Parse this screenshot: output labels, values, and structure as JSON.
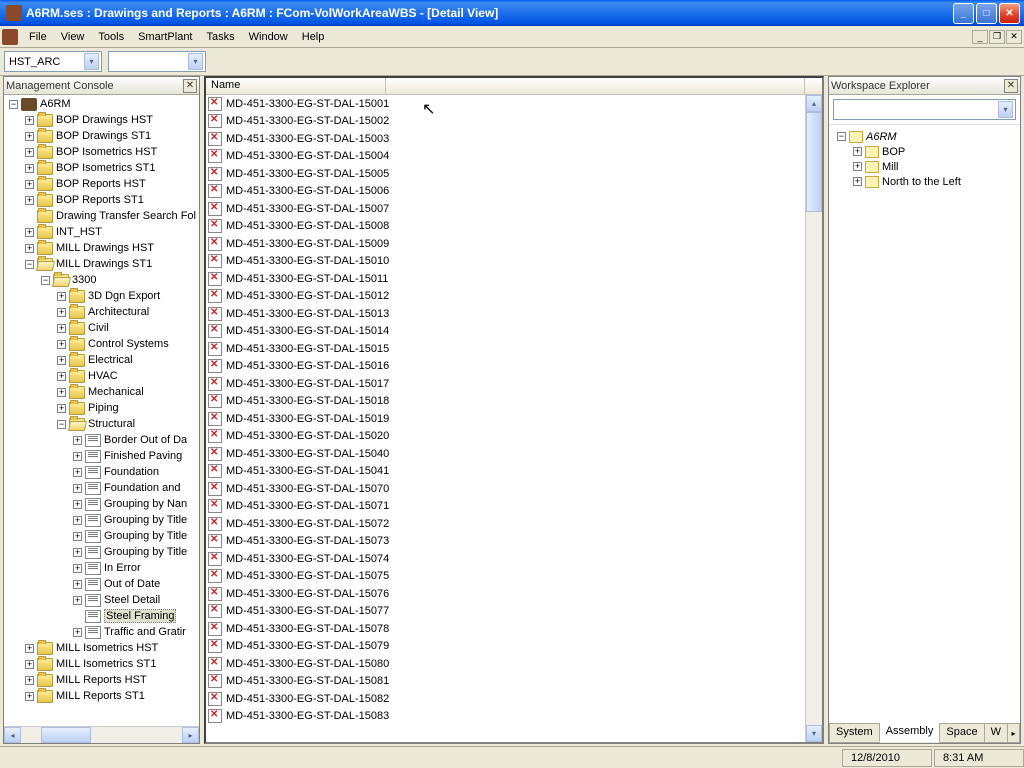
{
  "window": {
    "title": "A6RM.ses : Drawings and Reports : A6RM : FCom-VolWorkAreaWBS - [Detail View]"
  },
  "menu": {
    "items": [
      "File",
      "View",
      "Tools",
      "SmartPlant",
      "Tasks",
      "Window",
      "Help"
    ]
  },
  "toolbar": {
    "combo1_value": "HST_ARC",
    "combo2_value": ""
  },
  "left_panel": {
    "title": "Management Console",
    "tree": [
      {
        "depth": 0,
        "exp": "-",
        "icon": "root",
        "label": "A6RM"
      },
      {
        "depth": 1,
        "exp": "+",
        "icon": "folder",
        "label": "BOP Drawings HST"
      },
      {
        "depth": 1,
        "exp": "+",
        "icon": "folder",
        "label": "BOP Drawings ST1"
      },
      {
        "depth": 1,
        "exp": "+",
        "icon": "folder",
        "label": "BOP Isometrics HST"
      },
      {
        "depth": 1,
        "exp": "+",
        "icon": "folder",
        "label": "BOP Isometrics ST1"
      },
      {
        "depth": 1,
        "exp": "+",
        "icon": "folder",
        "label": "BOP Reports HST"
      },
      {
        "depth": 1,
        "exp": "+",
        "icon": "folder",
        "label": "BOP Reports ST1"
      },
      {
        "depth": 1,
        "exp": "",
        "icon": "folder",
        "label": "Drawing Transfer Search Fol"
      },
      {
        "depth": 1,
        "exp": "+",
        "icon": "folder",
        "label": "INT_HST"
      },
      {
        "depth": 1,
        "exp": "+",
        "icon": "folder",
        "label": "MILL Drawings HST"
      },
      {
        "depth": 1,
        "exp": "-",
        "icon": "folder-open",
        "label": "MILL Drawings ST1"
      },
      {
        "depth": 2,
        "exp": "-",
        "icon": "folder-open",
        "label": "3300"
      },
      {
        "depth": 3,
        "exp": "+",
        "icon": "folder",
        "label": "3D Dgn Export"
      },
      {
        "depth": 3,
        "exp": "+",
        "icon": "folder",
        "label": "Architectural"
      },
      {
        "depth": 3,
        "exp": "+",
        "icon": "folder",
        "label": "Civil"
      },
      {
        "depth": 3,
        "exp": "+",
        "icon": "folder",
        "label": "Control Systems"
      },
      {
        "depth": 3,
        "exp": "+",
        "icon": "folder",
        "label": "Electrical"
      },
      {
        "depth": 3,
        "exp": "+",
        "icon": "folder",
        "label": "HVAC"
      },
      {
        "depth": 3,
        "exp": "+",
        "icon": "folder",
        "label": "Mechanical"
      },
      {
        "depth": 3,
        "exp": "+",
        "icon": "folder",
        "label": "Piping"
      },
      {
        "depth": 3,
        "exp": "-",
        "icon": "folder-open",
        "label": "Structural"
      },
      {
        "depth": 4,
        "exp": "+",
        "icon": "doc",
        "label": "Border Out of Da"
      },
      {
        "depth": 4,
        "exp": "+",
        "icon": "doc",
        "label": "Finished Paving"
      },
      {
        "depth": 4,
        "exp": "+",
        "icon": "doc",
        "label": "Foundation"
      },
      {
        "depth": 4,
        "exp": "+",
        "icon": "doc",
        "label": "Foundation and"
      },
      {
        "depth": 4,
        "exp": "+",
        "icon": "doc",
        "label": "Grouping by Nan"
      },
      {
        "depth": 4,
        "exp": "+",
        "icon": "doc",
        "label": "Grouping by Title"
      },
      {
        "depth": 4,
        "exp": "+",
        "icon": "doc",
        "label": "Grouping by Title"
      },
      {
        "depth": 4,
        "exp": "+",
        "icon": "doc",
        "label": "Grouping by Title"
      },
      {
        "depth": 4,
        "exp": "+",
        "icon": "doc",
        "label": "In Error"
      },
      {
        "depth": 4,
        "exp": "+",
        "icon": "doc",
        "label": "Out of Date"
      },
      {
        "depth": 4,
        "exp": "+",
        "icon": "doc",
        "label": "Steel Detail"
      },
      {
        "depth": 4,
        "exp": "",
        "icon": "doc",
        "label": "Steel Framing",
        "selected": true
      },
      {
        "depth": 4,
        "exp": "+",
        "icon": "doc",
        "label": "Traffic and Gratir"
      },
      {
        "depth": 1,
        "exp": "+",
        "icon": "folder",
        "label": "MILL Isometrics HST"
      },
      {
        "depth": 1,
        "exp": "+",
        "icon": "folder",
        "label": "MILL Isometrics ST1"
      },
      {
        "depth": 1,
        "exp": "+",
        "icon": "folder",
        "label": "MILL Reports HST"
      },
      {
        "depth": 1,
        "exp": "+",
        "icon": "folder",
        "label": "MILL Reports ST1"
      }
    ]
  },
  "center_panel": {
    "column_header": "Name",
    "rows": [
      "MD-451-3300-EG-ST-DAL-15001",
      "MD-451-3300-EG-ST-DAL-15002",
      "MD-451-3300-EG-ST-DAL-15003",
      "MD-451-3300-EG-ST-DAL-15004",
      "MD-451-3300-EG-ST-DAL-15005",
      "MD-451-3300-EG-ST-DAL-15006",
      "MD-451-3300-EG-ST-DAL-15007",
      "MD-451-3300-EG-ST-DAL-15008",
      "MD-451-3300-EG-ST-DAL-15009",
      "MD-451-3300-EG-ST-DAL-15010",
      "MD-451-3300-EG-ST-DAL-15011",
      "MD-451-3300-EG-ST-DAL-15012",
      "MD-451-3300-EG-ST-DAL-15013",
      "MD-451-3300-EG-ST-DAL-15014",
      "MD-451-3300-EG-ST-DAL-15015",
      "MD-451-3300-EG-ST-DAL-15016",
      "MD-451-3300-EG-ST-DAL-15017",
      "MD-451-3300-EG-ST-DAL-15018",
      "MD-451-3300-EG-ST-DAL-15019",
      "MD-451-3300-EG-ST-DAL-15020",
      "MD-451-3300-EG-ST-DAL-15040",
      "MD-451-3300-EG-ST-DAL-15041",
      "MD-451-3300-EG-ST-DAL-15070",
      "MD-451-3300-EG-ST-DAL-15071",
      "MD-451-3300-EG-ST-DAL-15072",
      "MD-451-3300-EG-ST-DAL-15073",
      "MD-451-3300-EG-ST-DAL-15074",
      "MD-451-3300-EG-ST-DAL-15075",
      "MD-451-3300-EG-ST-DAL-15076",
      "MD-451-3300-EG-ST-DAL-15077",
      "MD-451-3300-EG-ST-DAL-15078",
      "MD-451-3300-EG-ST-DAL-15079",
      "MD-451-3300-EG-ST-DAL-15080",
      "MD-451-3300-EG-ST-DAL-15081",
      "MD-451-3300-EG-ST-DAL-15082",
      "MD-451-3300-EG-ST-DAL-15083"
    ]
  },
  "right_panel": {
    "title": "Workspace Explorer",
    "combo_value": "",
    "tree": [
      {
        "depth": 0,
        "exp": "-",
        "label": "A6RM",
        "italic": true
      },
      {
        "depth": 1,
        "exp": "+",
        "label": "BOP"
      },
      {
        "depth": 1,
        "exp": "+",
        "label": "Mill"
      },
      {
        "depth": 1,
        "exp": "+",
        "label": "North to the Left"
      }
    ],
    "tabs": [
      "System",
      "Assembly",
      "Space",
      "W"
    ],
    "active_tab": 1
  },
  "statusbar": {
    "date": "12/8/2010",
    "time": "8:31 AM"
  }
}
